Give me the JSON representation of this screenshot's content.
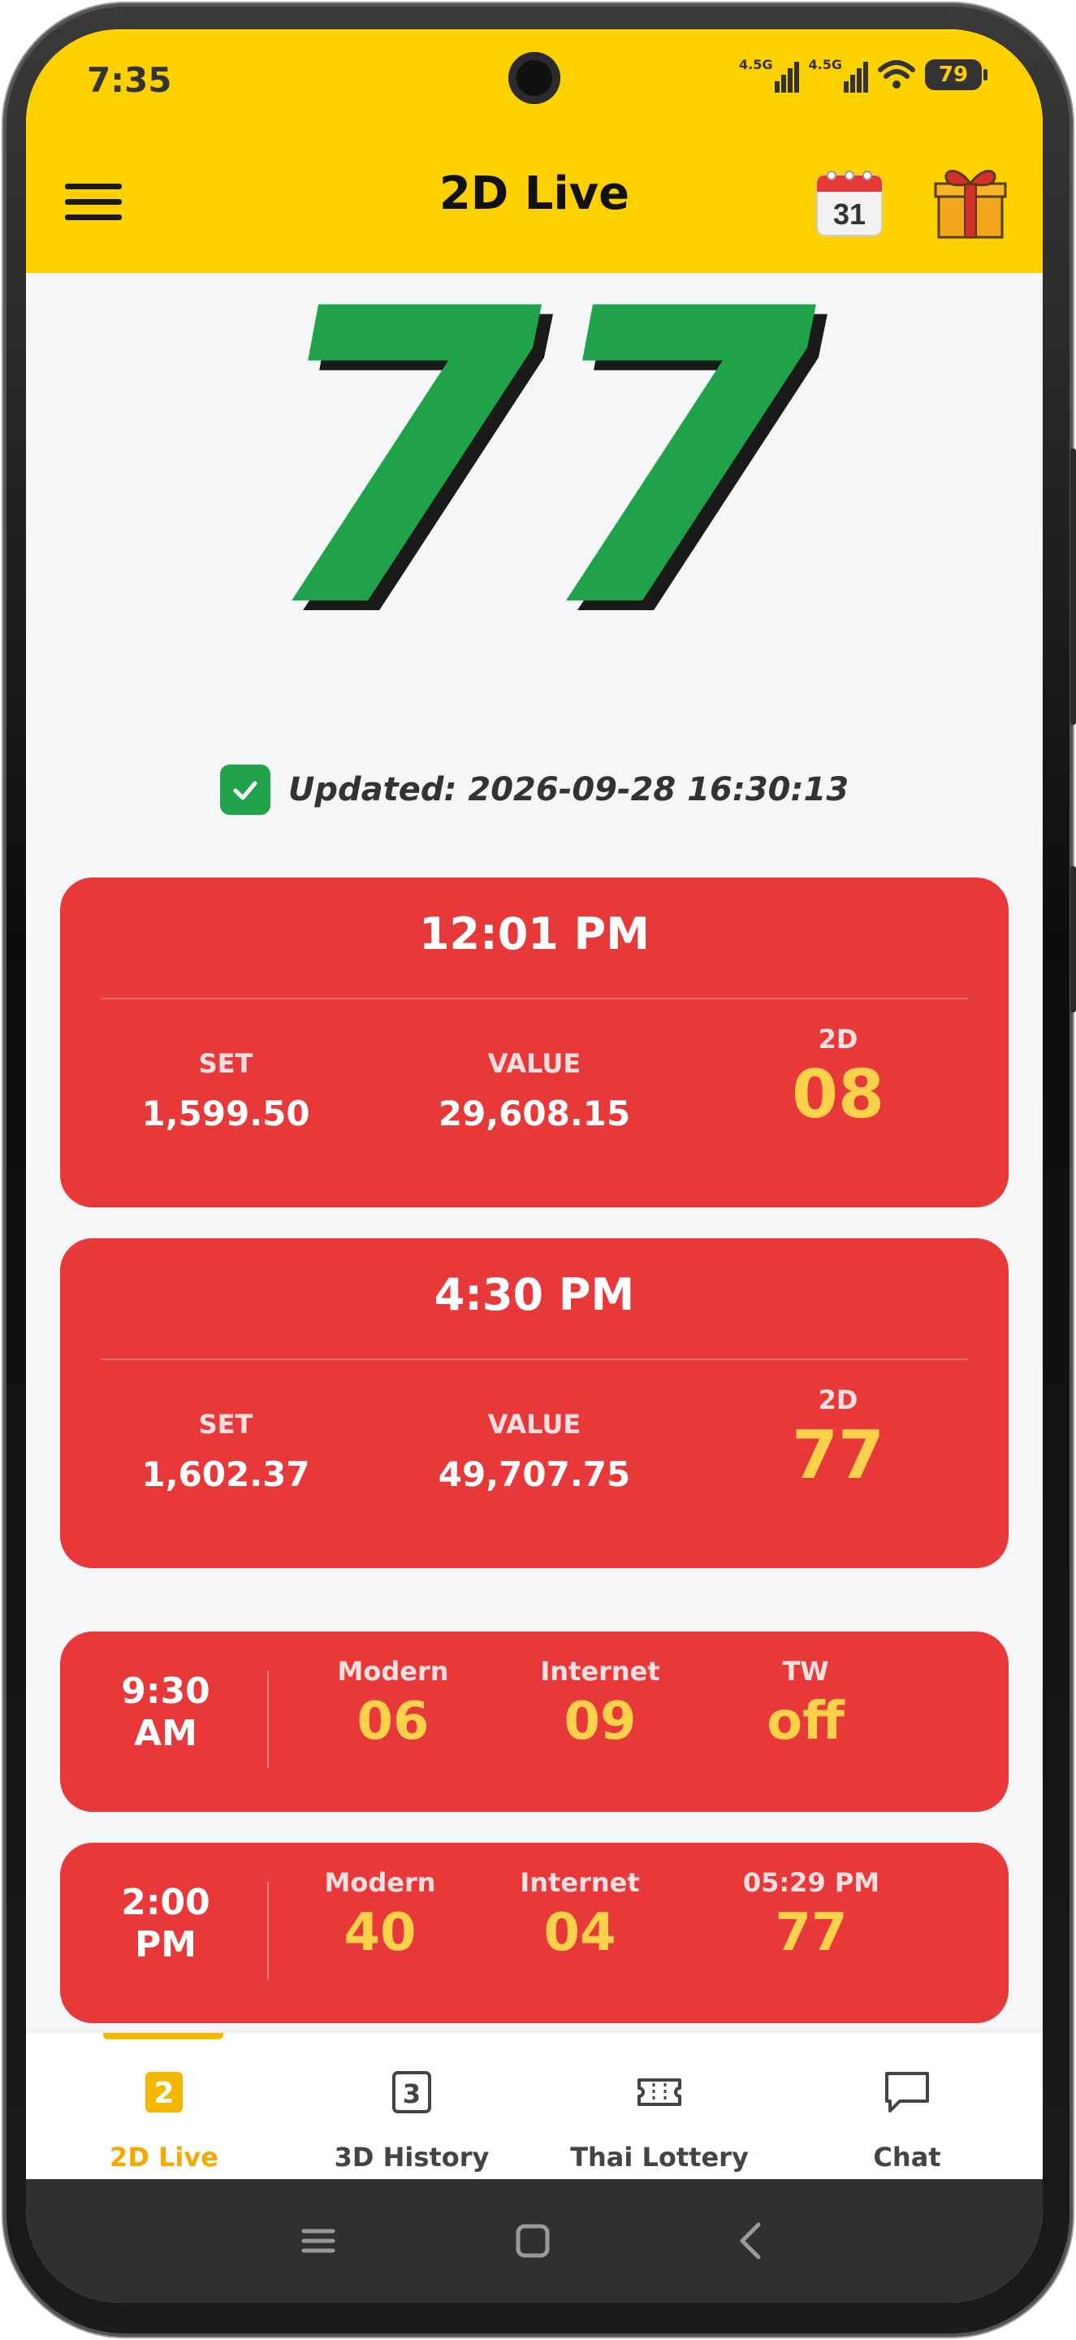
{
  "status": {
    "time": "7:35",
    "network1": "4.5G",
    "network2": "4.5G",
    "battery": "79"
  },
  "header": {
    "title": "2D Live",
    "calendar_day": "31"
  },
  "live": {
    "number": "77",
    "updated": "Updated: 2026-09-28 16:30:13"
  },
  "sessions": [
    {
      "time": "12:01 PM",
      "set_label": "SET",
      "set": "1,599.50",
      "value_label": "VALUE",
      "value": "29,608.15",
      "twod_label": "2D",
      "twod": "08"
    },
    {
      "time": "4:30 PM",
      "set_label": "SET",
      "set": "1,602.37",
      "value_label": "VALUE",
      "value": "49,707.75",
      "twod_label": "2D",
      "twod": "77"
    }
  ],
  "extras": [
    {
      "time_line1": "9:30",
      "time_line2": "AM",
      "c1_label": "Modern",
      "c1": "06",
      "c2_label": "Internet",
      "c2": "09",
      "c3_label": "TW",
      "c3": "off"
    },
    {
      "time_line1": "2:00",
      "time_line2": "PM",
      "c1_label": "Modern",
      "c1": "40",
      "c2_label": "Internet",
      "c2": "04",
      "c3_label": "05:29 PM",
      "c3": "77"
    }
  ],
  "nav": {
    "live_label": "2D Live",
    "live_icon_text": "2",
    "history_label": "3D History",
    "history_icon_text": "3",
    "thai_label": "Thai Lottery",
    "chat_label": "Chat"
  },
  "colors": {
    "header_yellow": "#fdd000",
    "card_red": "#e8393a",
    "big_number_green": "#1fa24a",
    "accent_gold": "#fdd24a",
    "active_nav": "#f5a800"
  }
}
